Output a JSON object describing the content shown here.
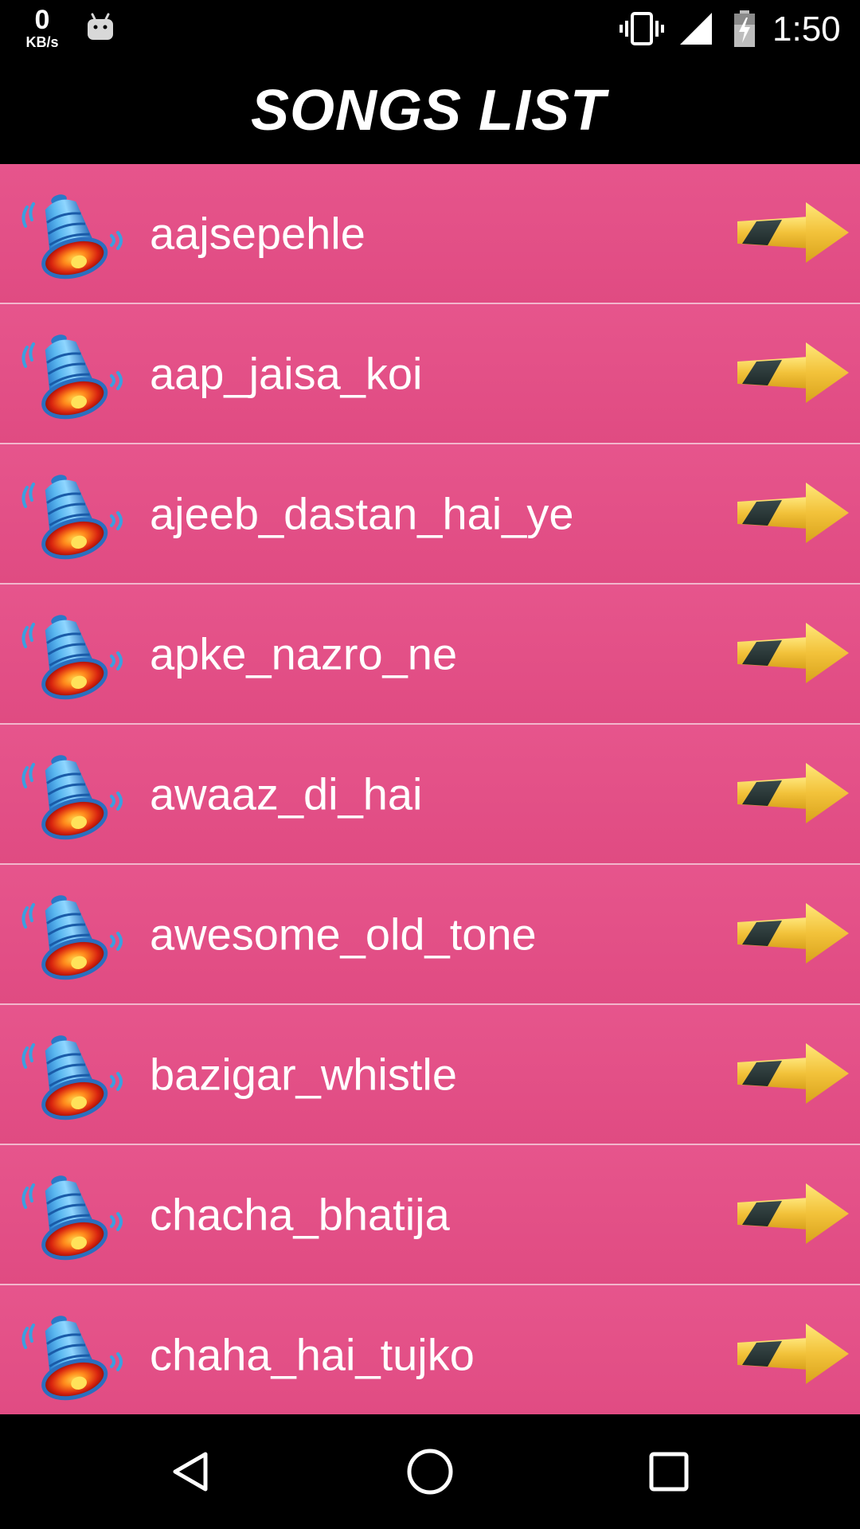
{
  "status_bar": {
    "network_speed_value": "0",
    "network_speed_unit": "KB/s",
    "time": "1:50",
    "icons": [
      "android-icon",
      "vibrate-icon",
      "signal-icon",
      "battery-charging-icon"
    ]
  },
  "header": {
    "title": "SONGS LIST"
  },
  "songs": [
    {
      "name": "aajsepehle"
    },
    {
      "name": "aap_jaisa_koi"
    },
    {
      "name": "ajeeb_dastan_hai_ye"
    },
    {
      "name": "apke_nazro_ne"
    },
    {
      "name": "awaaz_di_hai"
    },
    {
      "name": "awesome_old_tone"
    },
    {
      "name": "bazigar_whistle"
    },
    {
      "name": "chacha_bhatija"
    },
    {
      "name": "chaha_hai_tujko"
    }
  ],
  "row_icons": {
    "left": "bell-icon",
    "right": "arrow-right-icon"
  },
  "nav_bar": {
    "buttons": [
      "back-icon",
      "home-icon",
      "recents-icon"
    ]
  },
  "colors": {
    "row_background": "#e24d85",
    "row_divider": "#f2b6cc",
    "header_background": "#000000",
    "text": "#ffffff",
    "arrow_yellow": "#f2c744"
  }
}
